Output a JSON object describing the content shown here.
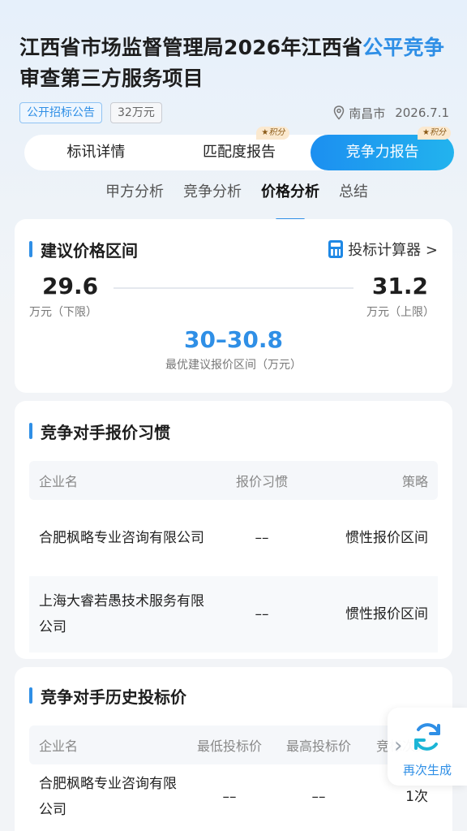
{
  "project": {
    "title_part1": "江西省市场监督管理局2026年江西省",
    "title_highlight": "公平竞争",
    "title_part2": "审查第三方服务项目",
    "tag_type": "公开招标公告",
    "tag_amount": "32万元",
    "location": "南昌市",
    "date": "2026.7.1"
  },
  "tabs": [
    {
      "label": "标讯详情",
      "badge": ""
    },
    {
      "label": "匹配度报告",
      "badge": "积分"
    },
    {
      "label": "竞争力报告",
      "badge": "积分"
    }
  ],
  "subtabs": [
    "甲方分析",
    "竞争分析",
    "价格分析",
    "总结"
  ],
  "price_card": {
    "title": "建议价格区间",
    "calculator": "投标计算器 >",
    "low_value": "29.6",
    "low_label": "万元（下限）",
    "high_value": "31.2",
    "high_label": "万元（上限）",
    "best_value": "30–30.8",
    "best_label": "最优建议报价区间（万元）"
  },
  "habit_card": {
    "title": "竞争对手报价习惯",
    "headers": [
      "企业名",
      "报价习惯",
      "策略"
    ],
    "rows": [
      {
        "name": "合肥枫略专业咨询有限公司",
        "habit": "––",
        "strategy": "惯性报价区间"
      },
      {
        "name": "上海大睿若愚技术服务有限公司",
        "habit": "––",
        "strategy": "惯性报价区间"
      }
    ]
  },
  "history_card": {
    "title": "竞争对手历史投标价",
    "headers": [
      "企业名",
      "最低投标价",
      "最高投标价",
      "竞标次数"
    ],
    "rows": [
      {
        "name": "合肥枫略专业咨询有限公司",
        "min": "––",
        "max": "––",
        "count": "1次"
      }
    ]
  },
  "regen": {
    "label": "再次生成"
  },
  "colors": {
    "accent": "#2f8fe6",
    "badge_bg": "#fbe9cf"
  }
}
